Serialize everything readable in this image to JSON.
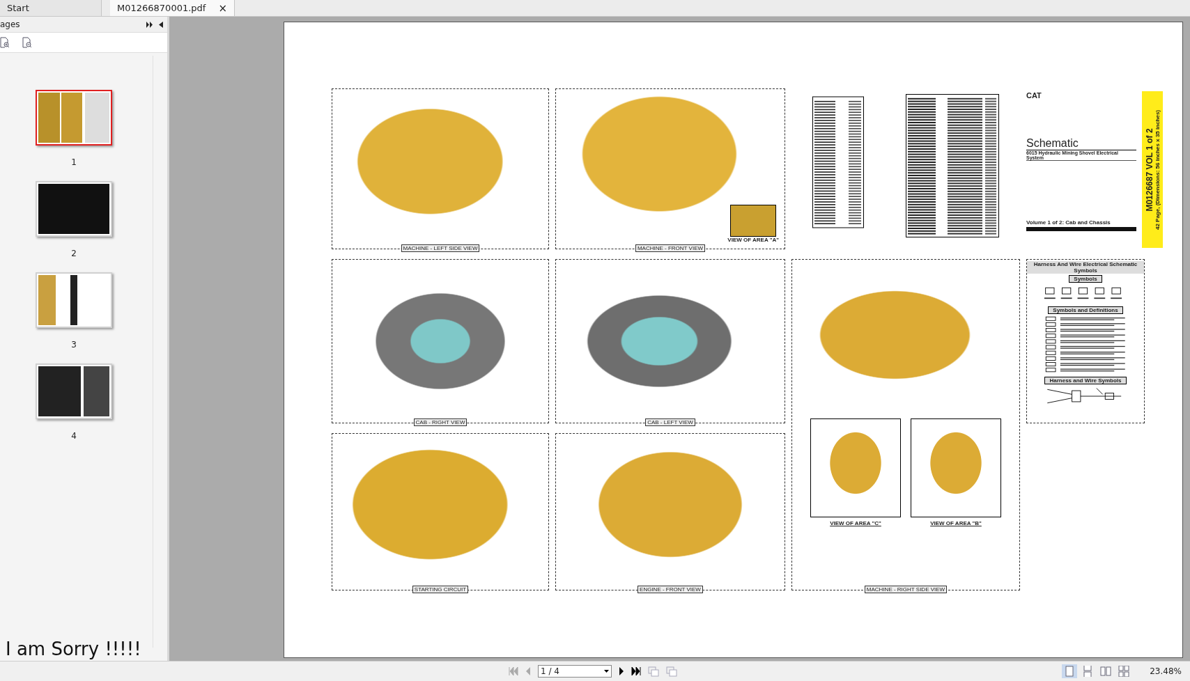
{
  "tabs": [
    {
      "label": "Start",
      "selected": false
    },
    {
      "label": "M01266870001.pdf",
      "selected": true,
      "close": "×"
    }
  ],
  "sidebar": {
    "title": "ages",
    "thumbnails": [
      {
        "label": "1",
        "selected": true
      },
      {
        "label": "2",
        "selected": false
      },
      {
        "label": "3",
        "selected": false
      },
      {
        "label": "4",
        "selected": false
      }
    ],
    "note": "I am Sorry !!!!!"
  },
  "document": {
    "panels": [
      {
        "caption": "MACHINE - LEFT SIDE VIEW"
      },
      {
        "caption": "MACHINE - FRONT VIEW",
        "inset": "VIEW OF AREA \"A\""
      },
      {
        "caption": "CAB - RIGHT VIEW"
      },
      {
        "caption": "CAB -  LEFT VIEW"
      },
      {
        "caption": "STARTING CIRCUIT"
      },
      {
        "caption": "ENGINE - FRONT VIEW"
      }
    ],
    "right_side": {
      "caption": "MACHINE - RIGHT SIDE VIEW",
      "areas": [
        "VIEW OF AREA \"C\"",
        "VIEW OF AREA \"B\""
      ]
    },
    "title_block": {
      "logo": "CAT",
      "title": "Schematic",
      "subtitle": "6015 Hydraulic Mining Shovel Electrical System",
      "volume": "Volume 1 of 2: Cab and Chassis",
      "strip_title": "M0126687 VOL 1 of 2",
      "strip_note": "42 Page, (Dimensions: 56 inches x 35 inches)"
    },
    "symbols_sheet": {
      "title": "Harness And Wire Electrical Schematic Symbols",
      "sections": [
        "Symbols",
        "Symbols and Definitions",
        "Harness and Wire Symbols"
      ]
    }
  },
  "toolbar": {
    "page_field": "1 / 4",
    "zoom": "23.48%",
    "view_modes": [
      {
        "kind": "single",
        "selected": true
      },
      {
        "kind": "continuous",
        "selected": false
      },
      {
        "kind": "facing",
        "selected": false
      },
      {
        "kind": "continuous-facing",
        "selected": false
      }
    ]
  }
}
